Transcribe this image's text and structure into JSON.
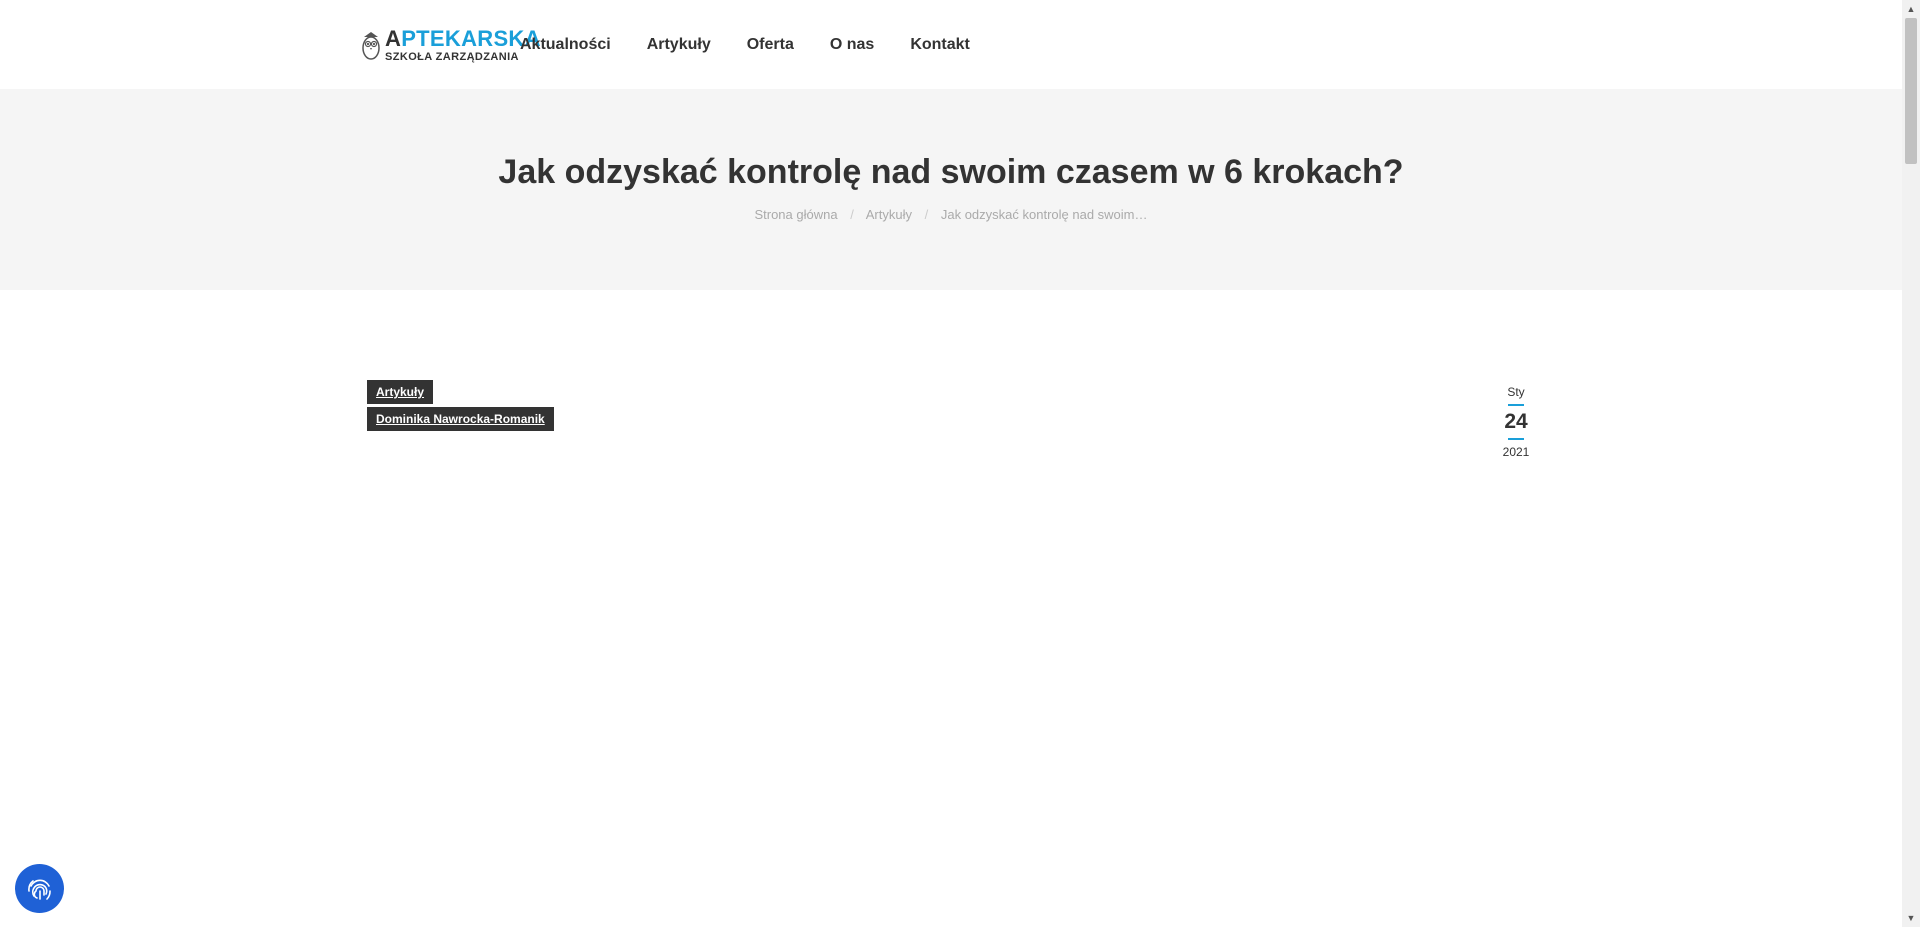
{
  "header": {
    "logo": {
      "line1_first": "A",
      "line1_rest": "PTEKARSKA",
      "line2": "SZKOŁA ZARZĄDZANIA"
    },
    "nav": [
      {
        "label": "Aktualności"
      },
      {
        "label": "Artykuły"
      },
      {
        "label": "Oferta"
      },
      {
        "label": "O nas"
      },
      {
        "label": "Kontakt"
      }
    ]
  },
  "title_band": {
    "title": "Jak odzyskać kontrolę nad swoim czasem w 6 krokach?",
    "breadcrumb": {
      "home": "Strona główna",
      "separator": "/",
      "category": "Artykuły",
      "current": "Jak odzyskać kontrolę nad swoim…"
    }
  },
  "post_meta": {
    "category_tag": "Artykuły",
    "author_tag": "Dominika Nawrocka-Romanik",
    "date": {
      "month": "Sty",
      "day": "24",
      "year": "2021"
    }
  },
  "colors": {
    "accent": "#1a9fd9",
    "dark": "#333333",
    "band_bg": "#f5f5f5",
    "privacy_button": "#1f61d6"
  },
  "icons": {
    "logo_mascot": "owl-icon",
    "privacy": "fingerprint-icon",
    "scroll_up": "scroll-up-arrow-icon",
    "scroll_down": "scroll-down-arrow-icon"
  }
}
